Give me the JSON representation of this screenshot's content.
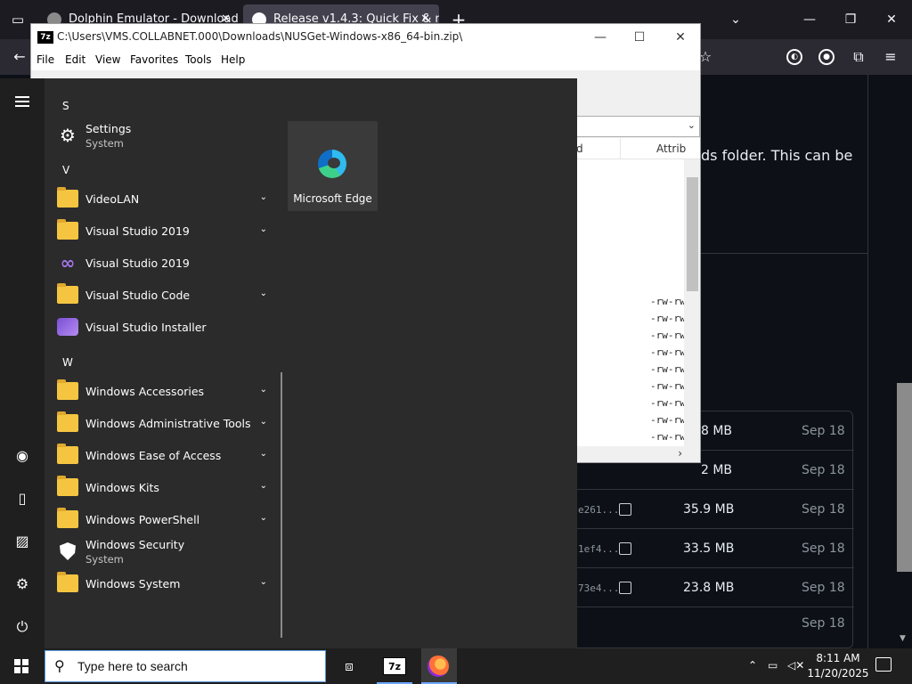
{
  "browser": {
    "tabs": [
      {
        "title": "Dolphin Emulator - Download"
      },
      {
        "title": "Release v1.4.3: Quick Fix & mac"
      }
    ],
    "web": {
      "partial_text": "ds folder. This can be",
      "assets": [
        {
          "hash": "",
          "size": "8 MB",
          "date": "Sep 18"
        },
        {
          "hash": "",
          "size": "2 MB",
          "date": "Sep 18"
        },
        {
          "hash": "e261...",
          "size": "35.9 MB",
          "date": "Sep 18"
        },
        {
          "hash": "1ef4...",
          "size": "33.5 MB",
          "date": "Sep 18"
        },
        {
          "hash": "73e4...",
          "size": "23.8 MB",
          "date": "Sep 18"
        },
        {
          "hash": "",
          "size": "",
          "date": "Sep 18"
        }
      ]
    }
  },
  "sevenzip": {
    "title": "C:\\Users\\VMS.COLLABNET.000\\Downloads\\NUSGet-Windows-x86_64-bin.zip\\",
    "logo": "7z",
    "menu": [
      "File",
      "Edit",
      "View",
      "Favorites",
      "Tools",
      "Help"
    ],
    "columns": [
      "d",
      "Attrib"
    ],
    "attributes": [
      "-rw-rw",
      "-rw-rw",
      "-rw-rw",
      "-rw-rw",
      "-rw-rw",
      "-rw-rw",
      "-rw-rw",
      "-rw-rw",
      "-rw-rw"
    ]
  },
  "startmenu": {
    "sections": [
      {
        "letter": "S",
        "apps": [
          {
            "name": "Settings",
            "sub": "System",
            "icon": "gear-icon",
            "expand": false
          }
        ]
      },
      {
        "letter": "V",
        "apps": [
          {
            "name": "VideoLAN",
            "icon": "folder-icon",
            "expand": true
          },
          {
            "name": "Visual Studio 2019",
            "icon": "folder-icon",
            "expand": true
          },
          {
            "name": "Visual Studio 2019",
            "icon": "visual-studio-icon",
            "expand": false
          },
          {
            "name": "Visual Studio Code",
            "icon": "folder-icon",
            "expand": true
          },
          {
            "name": "Visual Studio Installer",
            "icon": "visual-studio-installer-icon",
            "expand": false
          }
        ]
      },
      {
        "letter": "W",
        "apps": [
          {
            "name": "Windows Accessories",
            "icon": "folder-icon",
            "expand": true
          },
          {
            "name": "Windows Administrative Tools",
            "icon": "folder-icon",
            "expand": true
          },
          {
            "name": "Windows Ease of Access",
            "icon": "folder-icon",
            "expand": true
          },
          {
            "name": "Windows Kits",
            "icon": "folder-icon",
            "expand": true
          },
          {
            "name": "Windows PowerShell",
            "icon": "folder-icon",
            "expand": true
          },
          {
            "name": "Windows Security",
            "sub": "System",
            "icon": "shield-icon",
            "expand": false
          },
          {
            "name": "Windows System",
            "icon": "folder-icon",
            "expand": true
          }
        ]
      }
    ],
    "tile": {
      "label": "Microsoft Edge",
      "icon": "edge-icon"
    }
  },
  "taskbar": {
    "search_placeholder": "Type here to search",
    "sevenzip_label": "7z",
    "time": "8:11 AM",
    "date": "11/20/2025"
  }
}
